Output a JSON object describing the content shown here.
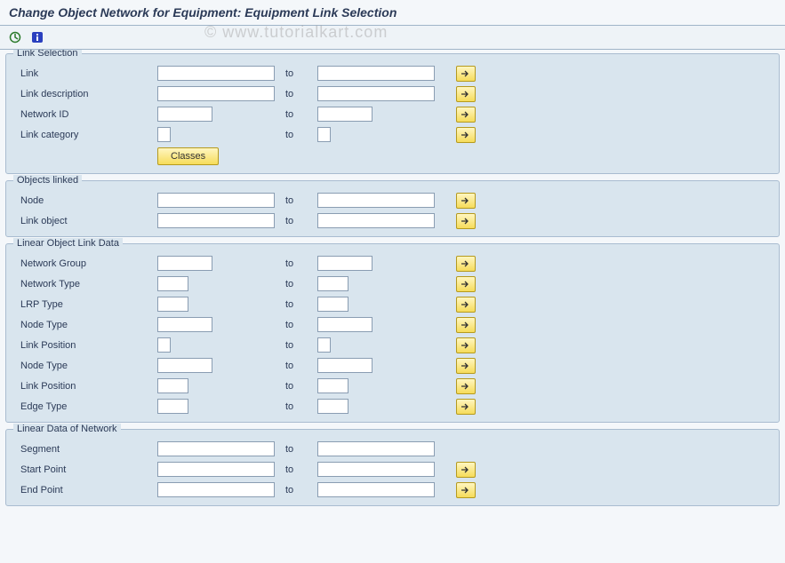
{
  "title": "Change Object Network for Equipment: Equipment Link Selection",
  "watermark": "© www.tutorialkart.com",
  "common": {
    "to": "to"
  },
  "groups": {
    "link_selection": {
      "title": "Link Selection",
      "link": "Link",
      "link_desc": "Link description",
      "network_id": "Network ID",
      "link_cat": "Link category",
      "classes": "Classes"
    },
    "objects_linked": {
      "title": "Objects linked",
      "node": "Node",
      "link_object": "Link object"
    },
    "lold": {
      "title": "Linear Object Link Data",
      "network_group": "Network Group",
      "network_type": "Network Type",
      "lrp_type": "LRP Type",
      "node_type1": "Node Type",
      "link_pos1": "Link Position",
      "node_type2": "Node Type",
      "link_pos2": "Link Position",
      "edge_type": "Edge Type"
    },
    "ldn": {
      "title": "Linear Data of Network",
      "segment": "Segment",
      "start_point": "Start Point",
      "end_point": "End Point"
    }
  }
}
